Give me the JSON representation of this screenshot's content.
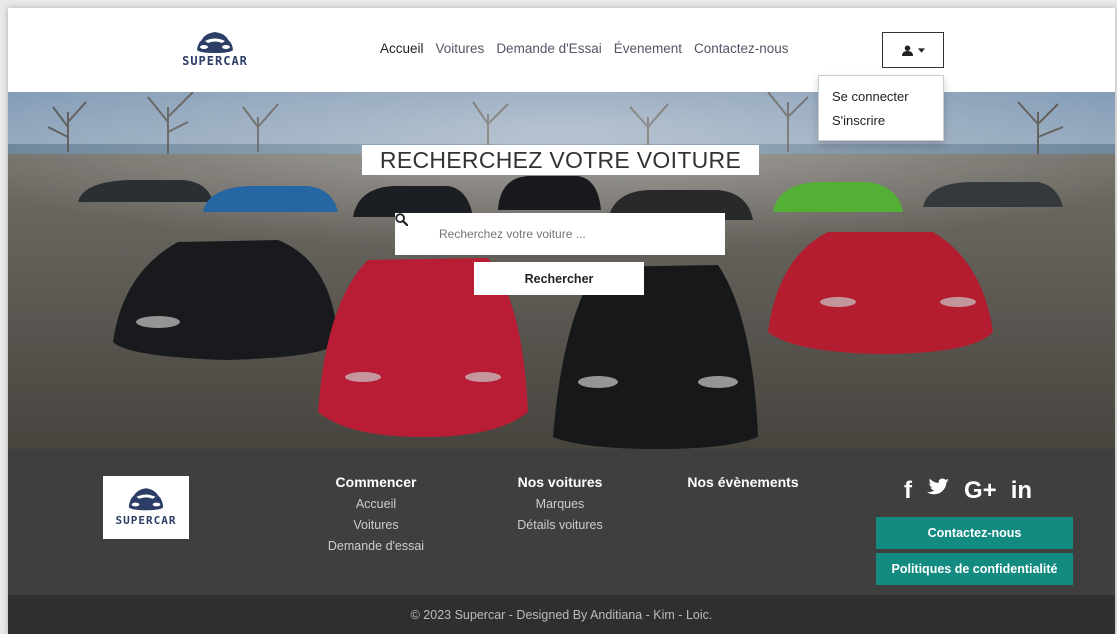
{
  "brand": {
    "logo_text": "SUPERCAR"
  },
  "nav": {
    "items": [
      {
        "label": "Accueil"
      },
      {
        "label": "Voitures"
      },
      {
        "label": "Demande d'Essai"
      },
      {
        "label": "Évenement"
      },
      {
        "label": "Contactez-nous"
      }
    ]
  },
  "user_menu": {
    "items": [
      {
        "label": "Se connecter"
      },
      {
        "label": "S'inscrire"
      }
    ]
  },
  "hero": {
    "title": "RECHERCHEZ VOTRE VOITURE",
    "search_placeholder": "Recherchez votre voiture ...",
    "search_button": "Rechercher"
  },
  "footer": {
    "columns": [
      {
        "title": "Commencer",
        "links": [
          "Accueil",
          "Voitures",
          "Demande d'essai"
        ]
      },
      {
        "title": "Nos voitures",
        "links": [
          "Marques",
          "Détails voitures"
        ]
      },
      {
        "title": "Nos évènements",
        "links": []
      }
    ],
    "social": [
      "f",
      "G+",
      "in"
    ],
    "contact_button": "Contactez-nous",
    "privacy_button": "Politiques de confidentialité",
    "copyright": "© 2023 Supercar - Designed By Anditiana - Kim - Loic."
  },
  "colors": {
    "accent": "#138b80",
    "footer_bg": "#3f3f3f",
    "copyright_bg": "#2f2f2f",
    "brand_navy": "#2c3e66"
  }
}
